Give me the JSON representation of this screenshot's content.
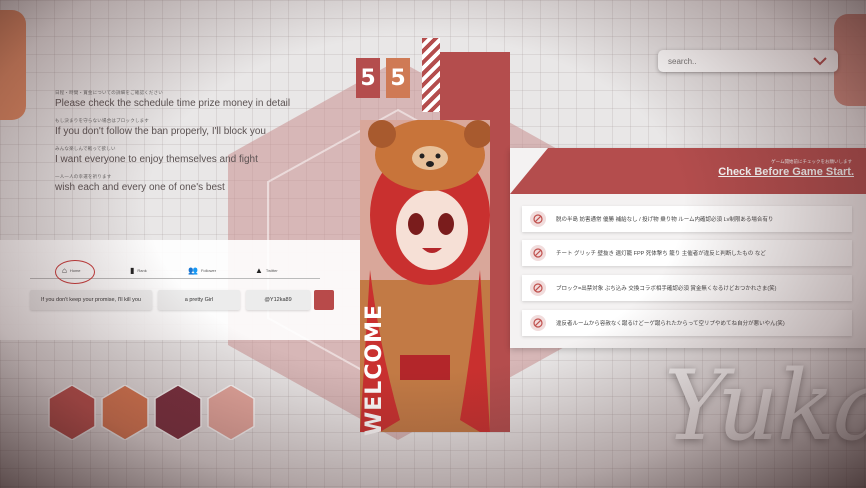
{
  "stream_number": [
    "5",
    "5"
  ],
  "info_lines": [
    {
      "small": "日程・時間・賞金についての詳細をご確認ください",
      "big": "Please check the schedule time prize money in detail"
    },
    {
      "small": "もし決まりを守らない場合はブロックします",
      "big": "If you don't follow the ban properly, I'll block you"
    },
    {
      "small": "みんな楽しんで戦って欲しい",
      "big": "I want everyone to enjoy themselves and fight"
    },
    {
      "small": "一人一人の幸運を祈ります",
      "big": "wish each and every one of one's best"
    }
  ],
  "nav": {
    "items": [
      {
        "label": "Home",
        "icon": "home-icon"
      },
      {
        "label": "Rank",
        "icon": "rank-icon"
      },
      {
        "label": "Follower",
        "icon": "people-icon"
      },
      {
        "label": "Twitter",
        "icon": "warning-icon"
      }
    ]
  },
  "profile_pills": [
    "If you don't keep your promise, I'll kill you",
    "a pretty Girl",
    "@Y12ka89"
  ],
  "search": {
    "placeholder": "search.."
  },
  "welcome": "WELCOME",
  "panel": {
    "subtitle": "ゲーム開始前にチェックをお願いします",
    "title": "Check Before Game Start.",
    "rules": [
      "脱の半島 妨害通常 優勝 補給なし / 投げ物 乗り物 ルーム内確認必須 Lv制限ある場合有り",
      "チート グリッチ 壁抜き 遺灯籠 FPP 死体撃ち 籠り 主催者が違反と判断したもの など",
      "ブロック=出禁対象 ぶち込み 交換コラボ相手確認必須 賞金無くなるけどおつかれさま(笑)",
      "違反者ルームから容赦なく蹴るけどーゲ蹴られたからって空リプやめてね自分が悪いやん(笑)"
    ]
  },
  "palette": [
    "#c0504d",
    "#e07b52",
    "#7a2e3e",
    "#e8aaa0"
  ],
  "signature": "Yuka"
}
